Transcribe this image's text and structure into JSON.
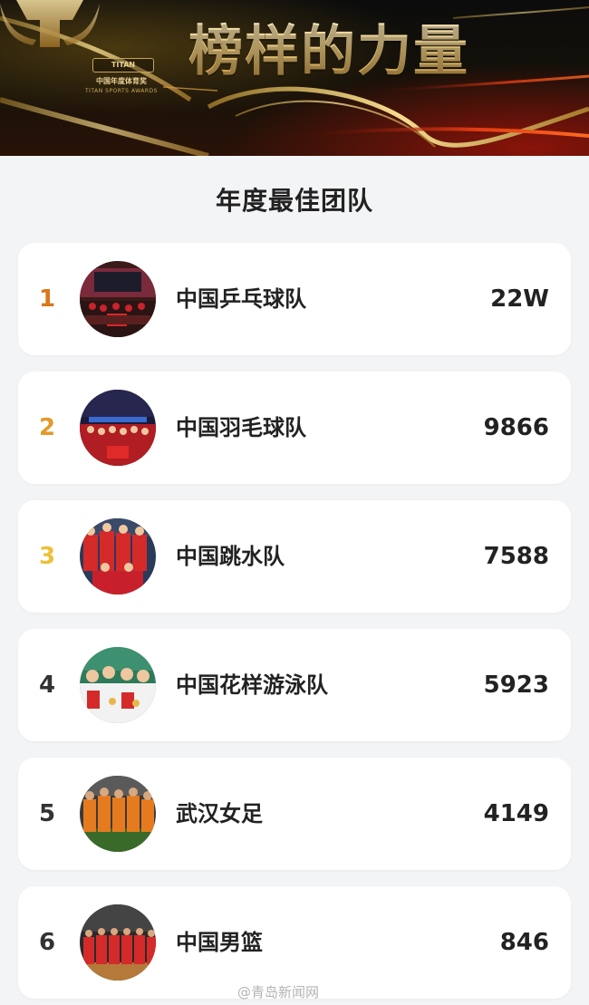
{
  "banner": {
    "title": "榜样的力量",
    "logo_brand": "TITAN",
    "logo_cn": "中国年度体育奖",
    "logo_en": "TITAN SPORTS AWARDS"
  },
  "section_title": "年度最佳团队",
  "teams": [
    {
      "rank": "1",
      "name": "中国乒乓球队",
      "votes": "22W",
      "rank_color": "#d9771b"
    },
    {
      "rank": "2",
      "name": "中国羽毛球队",
      "votes": "9866",
      "rank_color": "#e39a2c"
    },
    {
      "rank": "3",
      "name": "中国跳水队",
      "votes": "7588",
      "rank_color": "#ecc139"
    },
    {
      "rank": "4",
      "name": "中国花样游泳队",
      "votes": "5923",
      "rank_color": "#333333"
    },
    {
      "rank": "5",
      "name": "武汉女足",
      "votes": "4149",
      "rank_color": "#333333"
    },
    {
      "rank": "6",
      "name": "中国男篮",
      "votes": "846",
      "rank_color": "#333333"
    }
  ],
  "watermark": "@青岛新闻网"
}
